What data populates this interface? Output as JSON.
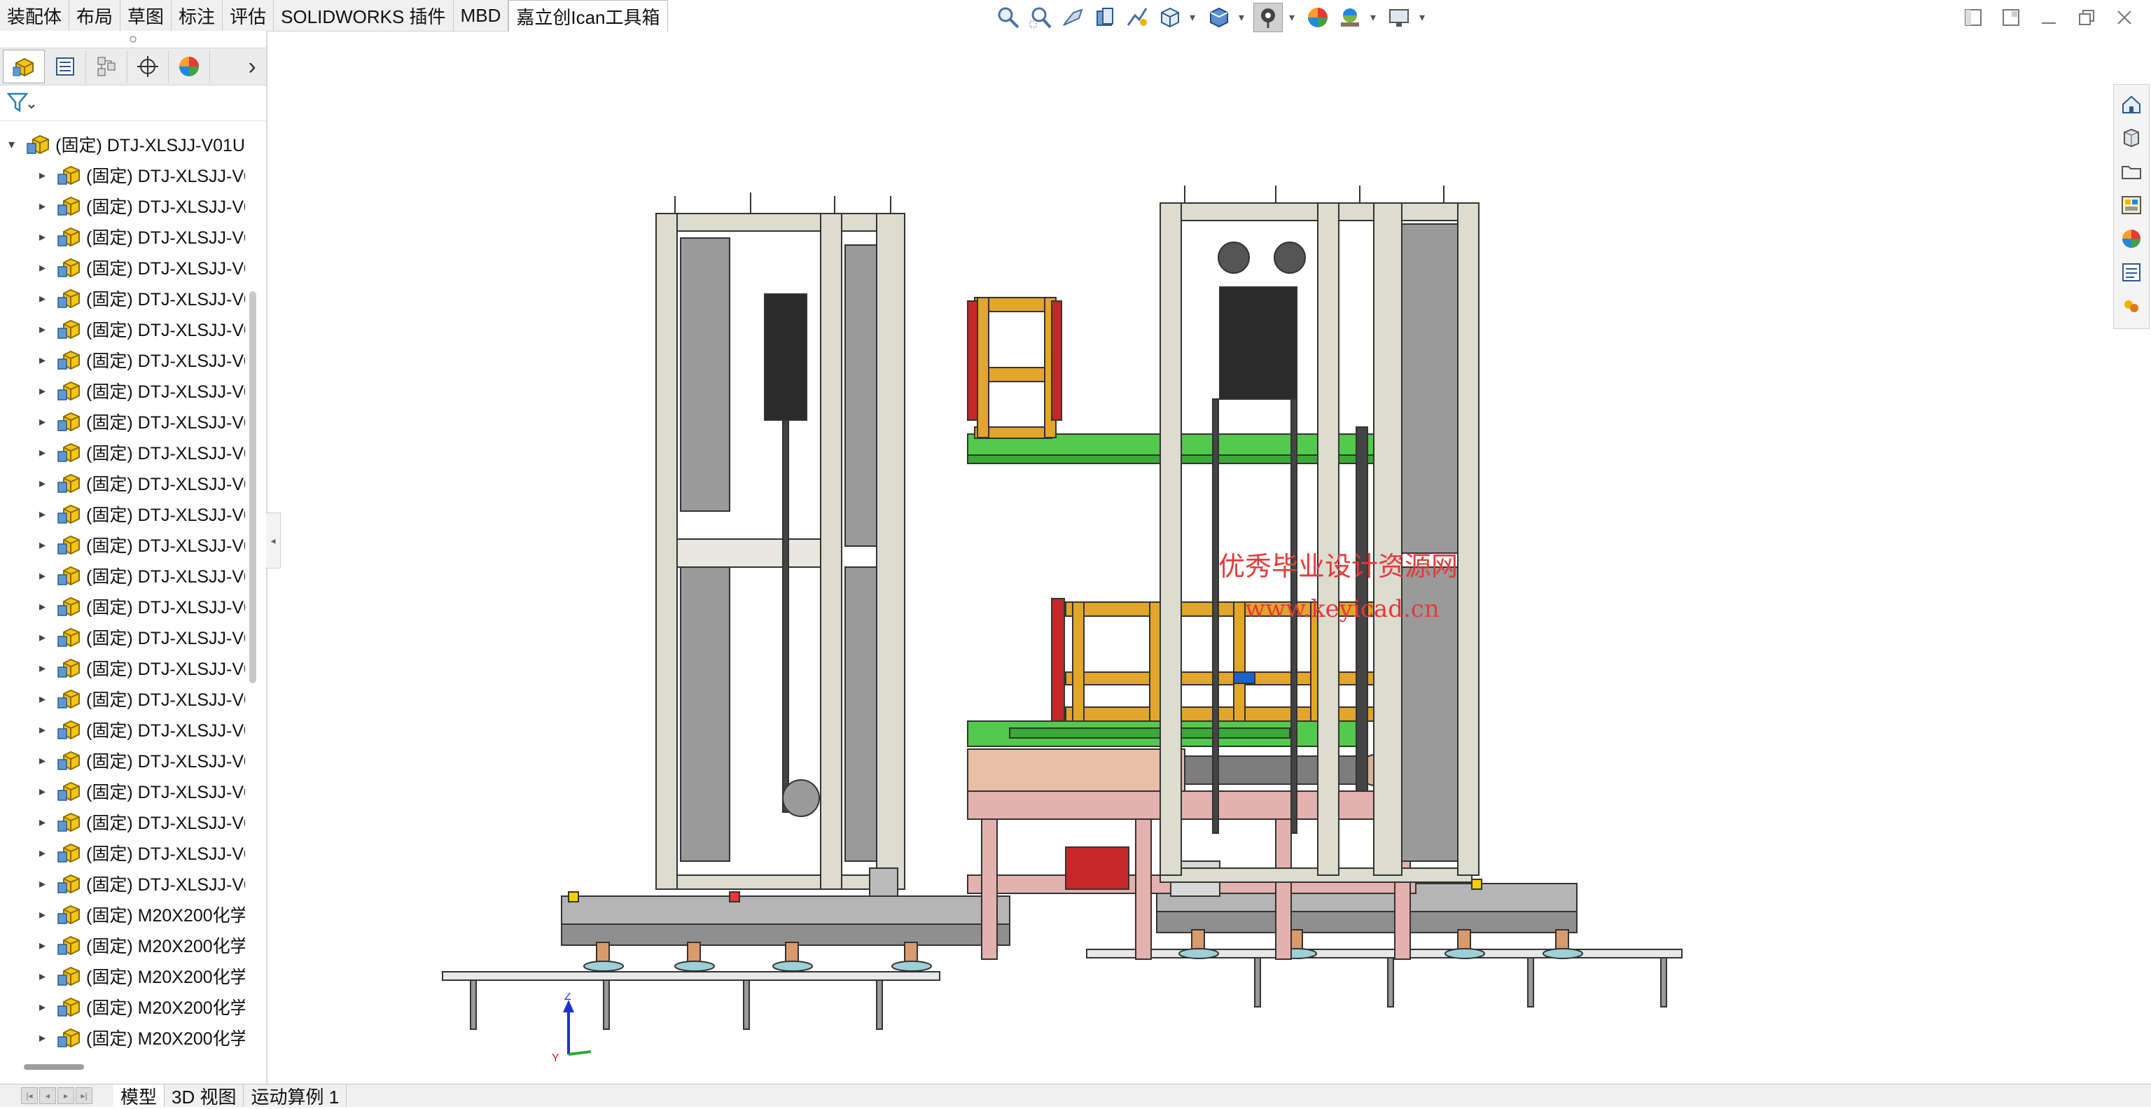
{
  "command_tabs": [
    {
      "label": "装配体",
      "active": false
    },
    {
      "label": "布局",
      "active": false
    },
    {
      "label": "草图",
      "active": false
    },
    {
      "label": "标注",
      "active": false
    },
    {
      "label": "评估",
      "active": false
    },
    {
      "label": "SOLIDWORKS 插件",
      "active": false
    },
    {
      "label": "MBD",
      "active": false
    },
    {
      "label": "嘉立创Ican工具箱",
      "active": true
    }
  ],
  "heads_up_toolbar": {
    "icons": [
      "zoom-to-fit-icon",
      "zoom-to-area-icon",
      "previous-view-icon",
      "section-view-icon",
      "dynamic-annotation-view-icon",
      "view-orientation-icon",
      "display-style-icon",
      "hide-show-items-icon",
      "edit-appearance-icon",
      "apply-scene-icon",
      "view-settings-icon"
    ]
  },
  "feature_manager": {
    "tabs": [
      "featuremanager-tree-icon",
      "propertymanager-icon",
      "configurationmanager-icon",
      "dimxpertmanager-icon",
      "displaymanager-icon"
    ],
    "root": {
      "label": "(固定) DTJ-XLSJJ-V01U"
    },
    "children": [
      "(固定) DTJ-XLSJJ-V0",
      "(固定) DTJ-XLSJJ-V0",
      "(固定) DTJ-XLSJJ-V0",
      "(固定) DTJ-XLSJJ-V0",
      "(固定) DTJ-XLSJJ-V0",
      "(固定) DTJ-XLSJJ-V0",
      "(固定) DTJ-XLSJJ-V0",
      "(固定) DTJ-XLSJJ-V0",
      "(固定) DTJ-XLSJJ-V0",
      "(固定) DTJ-XLSJJ-V0",
      "(固定) DTJ-XLSJJ-V0",
      "(固定) DTJ-XLSJJ-V0",
      "(固定) DTJ-XLSJJ-V0",
      "(固定) DTJ-XLSJJ-V0",
      "(固定) DTJ-XLSJJ-V0",
      "(固定) DTJ-XLSJJ-V0",
      "(固定) DTJ-XLSJJ-V0",
      "(固定) DTJ-XLSJJ-V0",
      "(固定) DTJ-XLSJJ-V0",
      "(固定) DTJ-XLSJJ-V0",
      "(固定) DTJ-XLSJJ-V0",
      "(固定) DTJ-XLSJJ-V0",
      "(固定) DTJ-XLSJJ-V0",
      "(固定) DTJ-XLSJJ-V0",
      "(固定) M20X200化学",
      "(固定) M20X200化学",
      "(固定) M20X200化学",
      "(固定) M20X200化学",
      "(固定) M20X200化学"
    ]
  },
  "bottom_tabs": [
    {
      "label": "模型",
      "active": true
    },
    {
      "label": "3D 视图",
      "active": false
    },
    {
      "label": "运动算例 1",
      "active": false
    }
  ],
  "task_pane_icons": [
    "solidworks-resources-icon",
    "design-library-icon",
    "file-explorer-icon",
    "view-palette-icon",
    "appearances-scenes-icon",
    "custom-properties-icon",
    "solidworks-forum-icon"
  ],
  "viewport": {
    "watermark_line1": "优秀毕业设计资源网",
    "watermark_line2": "www.keyicad.cn",
    "triad_z_label": "Z",
    "triad_y_label": "Y",
    "colors": {
      "frame": "#dcdccf",
      "panel": "#9a9a9a",
      "green": "#53c94d",
      "yellow": "#e1a62a",
      "red": "#c62828",
      "pink": "#e3b2ae",
      "base": "#8c8c8c"
    }
  }
}
